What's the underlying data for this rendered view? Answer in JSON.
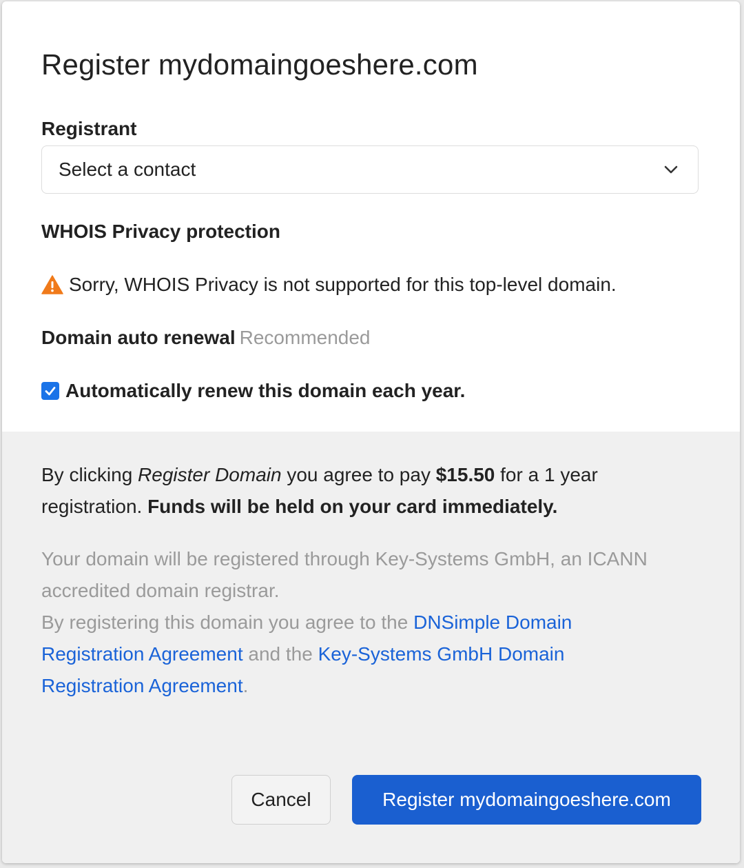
{
  "modal": {
    "title": "Register mydomaingoeshere.com"
  },
  "registrant": {
    "label": "Registrant",
    "select_value": "Select a contact"
  },
  "whois": {
    "label": "WHOIS Privacy protection",
    "warning": "Sorry, WHOIS Privacy is not supported for this top-level domain."
  },
  "auto_renewal": {
    "label": "Domain auto renewal",
    "hint": "Recommended",
    "checkbox_label": "Automatically renew this domain each year.",
    "checked": true
  },
  "agreement": {
    "prefix": "By clicking ",
    "action": "Register Domain",
    "middle": " you agree to pay ",
    "price": "$15.50",
    "suffix": " for a 1 year registration. ",
    "funds_notice": "Funds will be held on your card immediately."
  },
  "legal": {
    "registrar_line": "Your domain will be registered through Key-Systems GmbH, an ICANN accredited domain registrar.",
    "agree_prefix": "By registering this domain you agree to the ",
    "link1": "DNSimple Domain Registration Agreement",
    "and_the": " and the ",
    "link2": "Key-Systems GmbH Domain Registration Agreement",
    "end": "."
  },
  "buttons": {
    "cancel": "Cancel",
    "register": "Register mydomaingoeshere.com"
  },
  "colors": {
    "accent": "#1a5fd0",
    "link": "#1a63d8",
    "warning": "#f07a1a",
    "muted": "#9a9a9a"
  }
}
